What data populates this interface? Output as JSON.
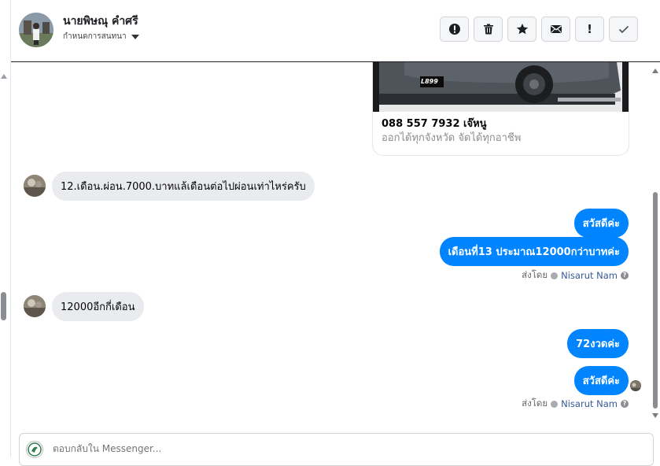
{
  "header": {
    "contact_name": "นายพิษณุ คำศรี",
    "conversation_label": "กำหนดการสนทนา",
    "actions": [
      {
        "name": "report-spam",
        "icon": "alert-circle-icon"
      },
      {
        "name": "delete",
        "icon": "trash-icon"
      },
      {
        "name": "star",
        "icon": "star-icon"
      },
      {
        "name": "mark-unread",
        "icon": "envelope-icon"
      },
      {
        "name": "important",
        "icon": "exclamation-icon",
        "text": "!"
      },
      {
        "name": "done",
        "icon": "check-icon"
      }
    ]
  },
  "shared_card": {
    "plate_text": "L899",
    "phone": "088 557 7932 เจ๊หนู",
    "description": "ออกได้ทุกจังหวัด จัดได้ทุกอาชีพ"
  },
  "messages": [
    {
      "direction": "in",
      "text": "12.เดือน.ผ่อน.7000.บาทแล้เดือนต่อไปผ่อนเท่าไหร่ครับ"
    },
    {
      "direction": "out",
      "text": "สวัสดีค่ะ"
    },
    {
      "direction": "out",
      "text": "เดือนที่13 ประมาณ12000กว่าบาทค่ะ"
    },
    {
      "direction": "in",
      "text": "12000อีกกี่เดือน"
    },
    {
      "direction": "out",
      "text": "72งวดค่ะ"
    },
    {
      "direction": "out",
      "text": "สวัสดีค่ะ"
    }
  ],
  "sent_by": {
    "prefix": "ส่งโดย",
    "name": "Nisarut Nam",
    "help": "?"
  },
  "reply": {
    "placeholder": "ตอบกลับใน Messenger..."
  },
  "colors": {
    "accent": "#0084ff",
    "incoming_bubble": "#e9ebee",
    "sender_name": "#385898"
  }
}
